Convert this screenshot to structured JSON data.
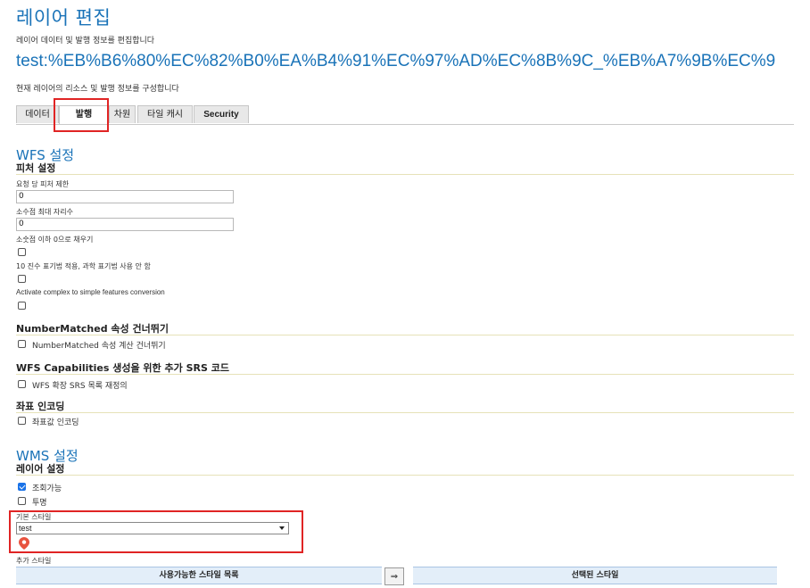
{
  "page": {
    "title": "레이어 편집",
    "subtitle": "레이어 데이터 및 발행 정보를 편집합니다",
    "layer_name": "test:%EB%B6%80%EC%82%B0%EA%B4%91%EC%97%AD%EC%8B%9C_%EB%A7%9B%EC%9",
    "layer_desc": "현재 레이어의 리소스 및 발행 정보를 구성합니다"
  },
  "tabs": [
    {
      "label": "데이터"
    },
    {
      "label": "발행"
    },
    {
      "label": "차원"
    },
    {
      "label": "타일 캐시"
    },
    {
      "label": "Security"
    }
  ],
  "wfs": {
    "title": "WFS 설정",
    "feature_settings": "피처 설정",
    "max_features_label": "요청 당 피처 제한",
    "max_features_value": "0",
    "max_decimals_label": "소수점 최대 자리수",
    "max_decimals_value": "0",
    "pad_zeros_label": "소숫점 이하 0으로 채우기",
    "no_sci_label": "10 진수 표기법 적용, 과학 표기법 사용 안 함",
    "complex_label": "Activate complex to simple features conversion",
    "numbermatched_head": "NumberMatched 속성 건너뛰기",
    "numbermatched_cb": "NumberMatched 속성 계산 건너뛰기",
    "srs_head": "WFS Capabilities 생성을 위한 추가 SRS 코드",
    "srs_cb": "WFS 확장 SRS 목록 재정의",
    "coord_head": "좌표 인코딩",
    "coord_cb": "좌표값 인코딩"
  },
  "wms": {
    "title": "WMS 설정",
    "layer_settings": "레이어 설정",
    "queryable_label": "조회가능",
    "queryable_checked": true,
    "opaque_label": "투명",
    "opaque_checked": false,
    "default_style_label": "기본 스타일",
    "default_style_value": "test",
    "additional_styles_label": "추가 스타일",
    "available_styles": "사용가능한 스타일 목록",
    "move_button": "⇒",
    "selected_styles": "선택된 스타일"
  },
  "colors": {
    "accent": "#1a73b8",
    "highlight": "#e02424",
    "marker": "#e8533f"
  }
}
